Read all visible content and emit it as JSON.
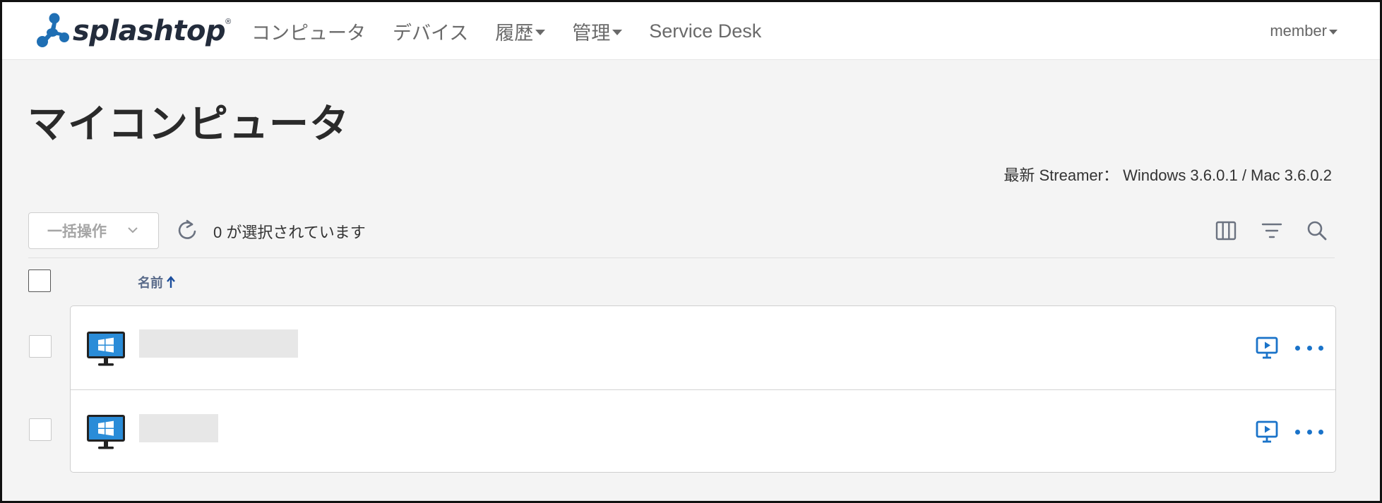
{
  "brand": {
    "name": "splashtop",
    "reg": "®"
  },
  "nav": {
    "items": [
      {
        "label": "コンピュータ",
        "dropdown": false
      },
      {
        "label": "デバイス",
        "dropdown": false
      },
      {
        "label": "履歴",
        "dropdown": true
      },
      {
        "label": "管理",
        "dropdown": true
      },
      {
        "label": "Service Desk",
        "dropdown": false
      }
    ],
    "user": "member"
  },
  "page": {
    "title": "マイコンピュータ",
    "streamer_info": "最新 Streamer： Windows 3.6.0.1 / Mac 3.6.0.2"
  },
  "toolbar": {
    "bulk_label": "一括操作",
    "selected_count": "0",
    "selected_text": "が選択されています",
    "icons": [
      "columns-icon",
      "filter-icon",
      "search-icon"
    ]
  },
  "table": {
    "name_header": "名前",
    "sort": "ascending",
    "rows": [
      {
        "os": "windows",
        "name": ""
      },
      {
        "os": "windows",
        "name": ""
      }
    ]
  },
  "colors": {
    "accent": "#1a73c9",
    "brand": "#232c3c",
    "brand_mark": "#1f6fb4",
    "windows": "#2a8cd8"
  }
}
